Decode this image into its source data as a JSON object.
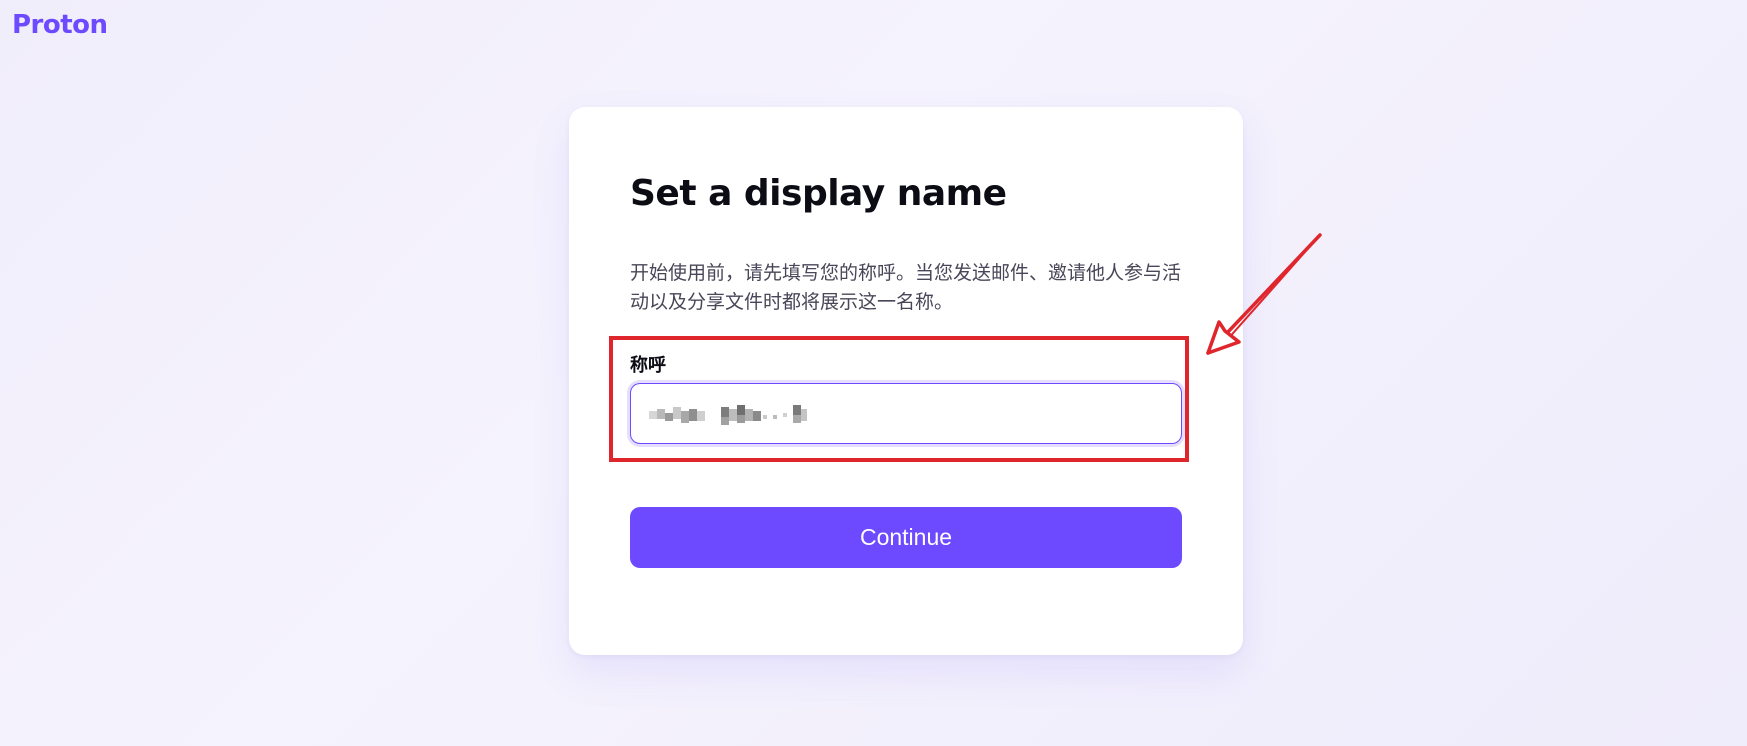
{
  "brand": {
    "name": "Proton",
    "color": "#6d4aff"
  },
  "card": {
    "title": "Set a display name",
    "description": "开始使用前，请先填写您的称呼。当您发送邮件、邀请他人参与活动以及分享文件时都将展示这一名称。",
    "field": {
      "label": "称呼",
      "value": ""
    },
    "continue_label": "Continue"
  },
  "annotation": {
    "highlight_color": "#e0262d"
  },
  "colors": {
    "accent": "#6d4aff",
    "background": "#f3f0fd"
  }
}
